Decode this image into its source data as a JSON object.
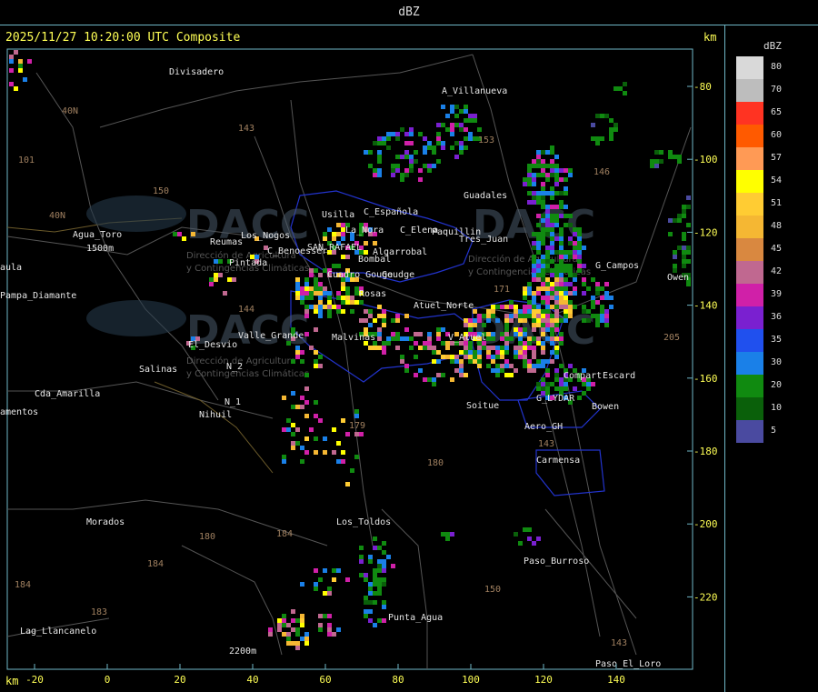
{
  "window": {
    "title": "dBZ"
  },
  "timestamp": "2025/11/27 10:20:00 UTC Composite",
  "axis": {
    "unit": "km",
    "x_ticks": [
      "-20",
      "0",
      "20",
      "40",
      "60",
      "80",
      "100",
      "120",
      "140"
    ],
    "y_ticks": [
      "-80",
      "-100",
      "-120",
      "-140",
      "-160",
      "-180",
      "-200",
      "-220"
    ]
  },
  "legend": {
    "title": "dBZ",
    "entries": [
      {
        "label": "80",
        "color": "#d9d9d9"
      },
      {
        "label": "70",
        "color": "#bdbdbd"
      },
      {
        "label": "65",
        "color": "#ff3322"
      },
      {
        "label": "60",
        "color": "#ff5a00"
      },
      {
        "label": "57",
        "color": "#ff9a55"
      },
      {
        "label": "54",
        "color": "#ffff00"
      },
      {
        "label": "51",
        "color": "#ffcc33"
      },
      {
        "label": "48",
        "color": "#f5b733"
      },
      {
        "label": "45",
        "color": "#d98840"
      },
      {
        "label": "42",
        "color": "#c06890"
      },
      {
        "label": "39",
        "color": "#d020a8"
      },
      {
        "label": "36",
        "color": "#7a20d0"
      },
      {
        "label": "35",
        "color": "#2050ee"
      },
      {
        "label": "30",
        "color": "#1a80e8"
      },
      {
        "label": "20",
        "color": "#108a10"
      },
      {
        "label": "10",
        "color": "#0a600a"
      },
      {
        "label": "5",
        "color": "#4a4aa0"
      }
    ]
  },
  "watermark": {
    "brand": "DACC",
    "subtitle_1": "Dirección de Agricultura",
    "subtitle_2": "y Contingencias Climáticas"
  },
  "places": [
    {
      "name": "Divisadero"
    },
    {
      "name": "A_Villanueva"
    },
    {
      "name": "Guadales"
    },
    {
      "name": "Agua_Toro"
    },
    {
      "name": "1500m"
    },
    {
      "name": "Pampa_Diamante"
    },
    {
      "name": "Reumas"
    },
    {
      "name": "Los_Nogos"
    },
    {
      "name": "Pintada"
    },
    {
      "name": "Usilla"
    },
    {
      "name": "La_Nora"
    },
    {
      "name": "C_Española"
    },
    {
      "name": "C_Elena"
    },
    {
      "name": "Paquillin"
    },
    {
      "name": "Tres_Juan"
    },
    {
      "name": "C_Benoesser"
    },
    {
      "name": "SAN_RAFAEL"
    },
    {
      "name": "Bombal"
    },
    {
      "name": "Algarrobal"
    },
    {
      "name": "Cuadro Gouge"
    },
    {
      "name": "Goudge"
    },
    {
      "name": "Rosas"
    },
    {
      "name": "Atuel_Norte"
    },
    {
      "name": "Valle_Grande"
    },
    {
      "name": "Malvinas"
    },
    {
      "name": "V_Atuel"
    },
    {
      "name": "El_Desvio"
    },
    {
      "name": "Salinas"
    },
    {
      "name": "N_2"
    },
    {
      "name": "N_1"
    },
    {
      "name": "Nihuil"
    },
    {
      "name": "Cda_Amarilla"
    },
    {
      "name": "amentos"
    },
    {
      "name": "G_Campos"
    },
    {
      "name": "Compart"
    },
    {
      "name": "Escard"
    },
    {
      "name": "G_LYDAR"
    },
    {
      "name": "Bowen"
    },
    {
      "name": "Soitue"
    },
    {
      "name": "Aero_GH"
    },
    {
      "name": "Carmensa"
    },
    {
      "name": "Morados"
    },
    {
      "name": "Los_Toldos"
    },
    {
      "name": "Paso_Burroso"
    },
    {
      "name": "Punta_Agua"
    },
    {
      "name": "Lag_Llancanelo"
    },
    {
      "name": "Paso_El_Loro"
    },
    {
      "name": "2200m"
    },
    {
      "name": "aula"
    },
    {
      "name": "Owen"
    }
  ],
  "routes": [
    "143",
    "40N",
    "101",
    "150",
    "40N",
    "153",
    "146",
    "171",
    "179",
    "184",
    "180",
    "184",
    "184",
    "183",
    "150",
    "143",
    "205",
    "180",
    "143",
    "144"
  ]
}
